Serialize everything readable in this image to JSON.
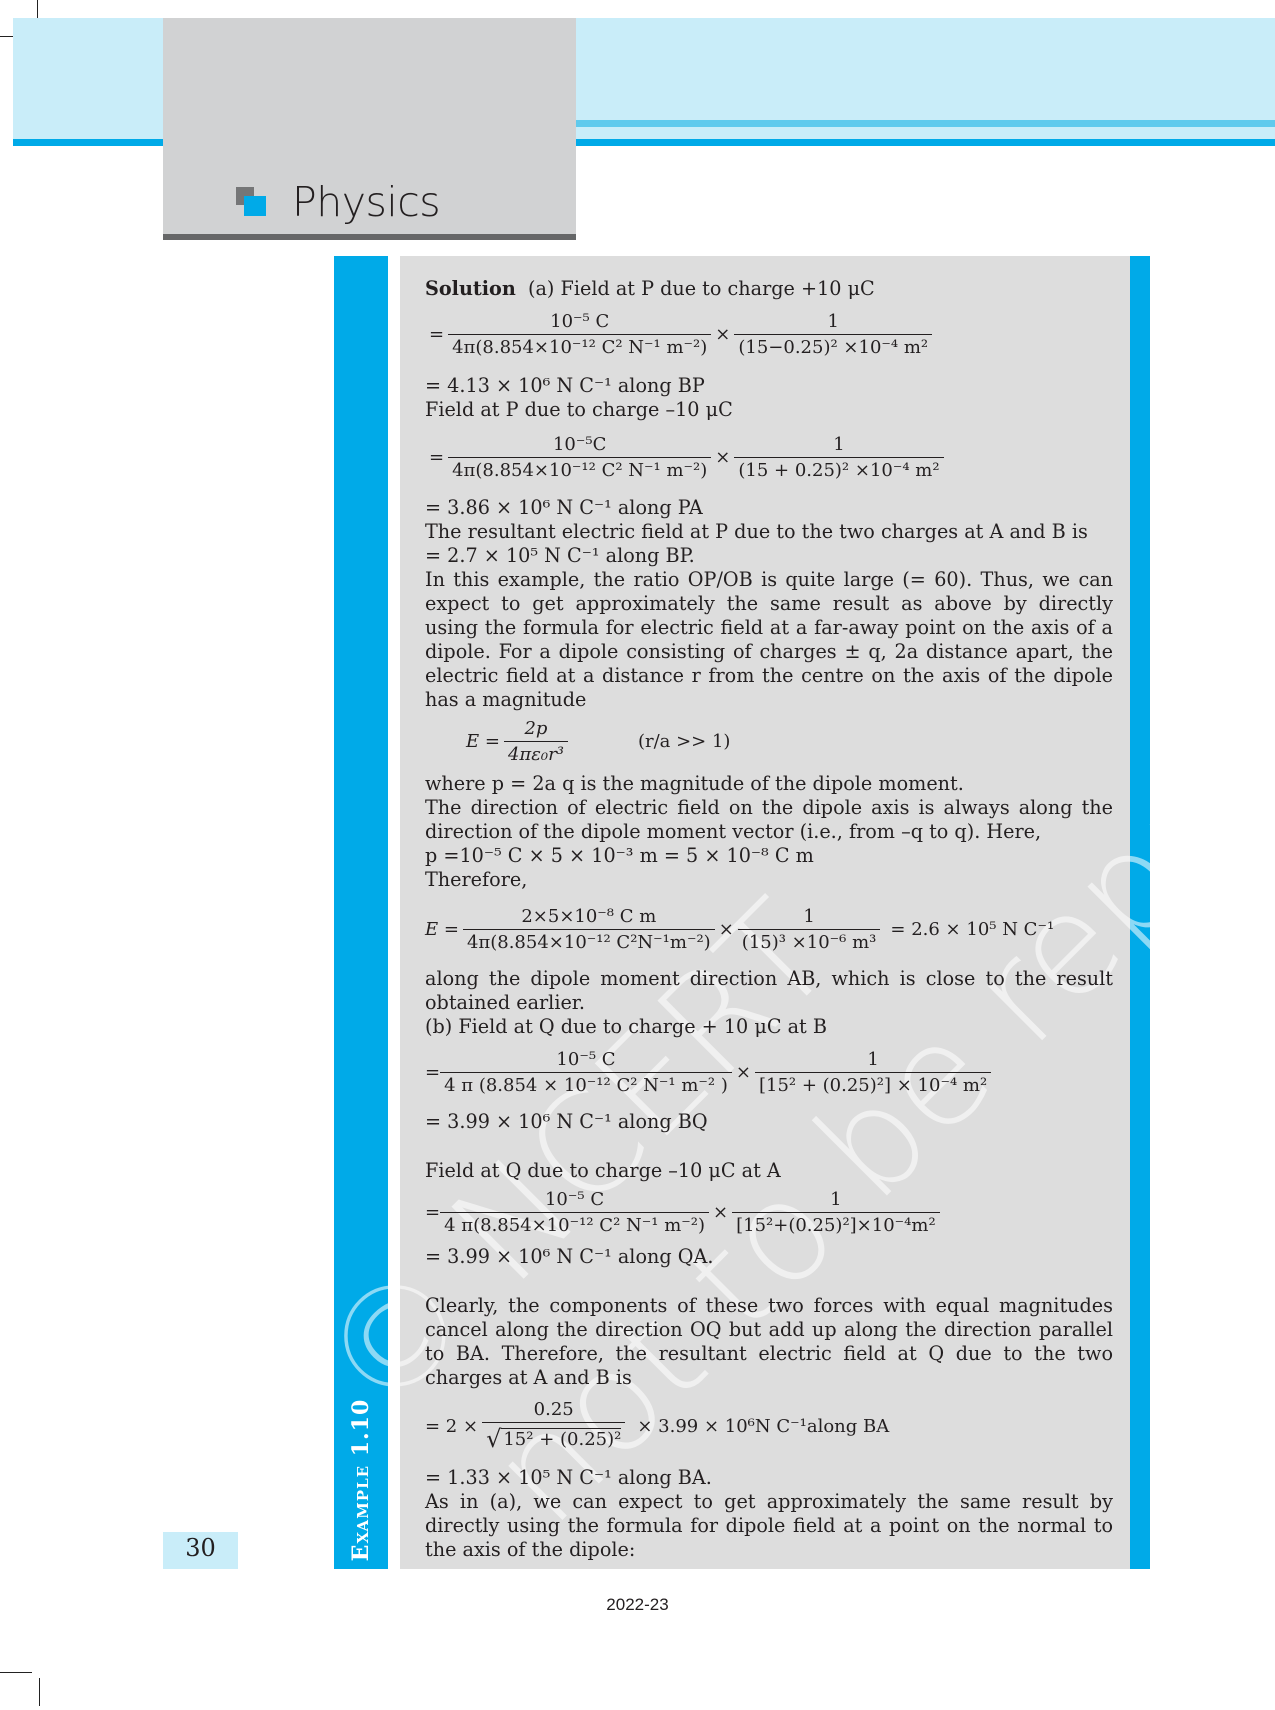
{
  "header": {
    "subject": "Physics",
    "logo_icon": "overlapping-squares-icon",
    "colors": {
      "accent_blue": "#00aae8",
      "light_blue": "#c9edf9",
      "header_grey": "#d1d2d3",
      "content_grey": "#dddddd"
    }
  },
  "example": {
    "label": "Example 1.10"
  },
  "watermark": {
    "line1": "© NCERT",
    "line2": "not to be republished"
  },
  "solution": {
    "heading": "Solution",
    "part_a_intro": "(a) Field at P due to charge +10 μC",
    "eq1": {
      "prefix": "=",
      "f1_num": "10⁻⁵ C",
      "f1_den": "4π(8.854×10⁻¹² C² N⁻¹ m⁻²)",
      "times": "×",
      "f2_num": "1",
      "f2_den": "(15−0.25)² ×10⁻⁴ m²"
    },
    "result1": "=  4.13 × 10⁶  N C⁻¹  along BP",
    "field_minus_intro": "Field at P due to charge –10 μC",
    "eq2": {
      "prefix": "=",
      "f1_num": "10⁻⁵C",
      "f1_den": "4π(8.854×10⁻¹² C² N⁻¹ m⁻²)",
      "times": "×",
      "f2_num": "1",
      "f2_den": "(15 + 0.25)² ×10⁻⁴ m²"
    },
    "result2": "=  3.86 × 10⁶  N C⁻¹ along PA",
    "resultant_line": "The resultant electric field at P due to the two charges at A and B is",
    "resultant_value": "=  2.7 × 10⁵  N C⁻¹  along BP.",
    "paragraph1": "In this example, the ratio OP/OB is quite large (= 60). Thus, we can expect to get approximately the same result as above by directly using the formula for electric field at a far-away point on the axis of a dipole. For a dipole consisting of charges ± q, 2a distance apart, the electric field at a distance r from the centre on the axis of the dipole has a magnitude",
    "dipole_eq": {
      "lhs": "E =",
      "num": "2p",
      "den": "4πε₀r³",
      "condition": "(r/a >> 1)"
    },
    "where_line": "where p = 2a q is the magnitude of the dipole moment.",
    "paragraph2": "The direction of electric field on the dipole axis is always along the direction of the dipole moment vector (i.e., from –q to q). Here,",
    "p_value": "p =10⁻⁵ C × 5 × 10⁻³ m  = 5 × 10⁻⁸ C m",
    "therefore": "Therefore,",
    "eq3": {
      "lhs": "E  =",
      "f1_num": "2×5×10⁻⁸ C m",
      "f1_den": "4π(8.854×10⁻¹² C²N⁻¹m⁻²)",
      "times": "×",
      "f2_num": "1",
      "f2_den": "(15)³ ×10⁻⁶ m³",
      "result": "= 2.6 × 10⁵  N C⁻¹"
    },
    "paragraph3": "along the dipole moment direction AB, which is close to the result obtained earlier.",
    "part_b_intro": "(b) Field at Q due to charge + 10 μC at B",
    "eq4": {
      "prefix": "=",
      "f1_num": "10⁻⁵ C",
      "f1_den": "4 π (8.854 × 10⁻¹² C²  N⁻¹  m⁻² )",
      "times": "×",
      "f2_num": "1",
      "f2_den": "[15² + (0.25)²] × 10⁻⁴  m²"
    },
    "result4": "=  3.99 × 10⁶  N C⁻¹ along BQ",
    "field_q_minus_intro": "Field at Q due to charge –10 μC at A",
    "eq5": {
      "prefix": "=",
      "f1_num": "10⁻⁵ C",
      "f1_den": "4 π(8.854×10⁻¹² C² N⁻¹ m⁻²)",
      "times": "×",
      "f2_num": "1",
      "f2_den": "[15²+(0.25)²]×10⁻⁴m²"
    },
    "result5": "=  3.99 × 10⁶  N C⁻¹ along QA.",
    "paragraph4": "Clearly, the components of these two forces with equal magnitudes cancel along the direction OQ but add up along the direction parallel to BA. Therefore, the resultant electric field at Q due to the two charges at A and B is",
    "eq6": {
      "prefix": "= 2 ×",
      "num": "0.25",
      "den_radicand": "15²  +  (0.25)²",
      "rest": "×  3.99  ×  10⁶N C⁻¹along BA"
    },
    "result6": "=  1.33 × 10⁵  N C⁻¹ along BA.",
    "paragraph5": "As in (a), we can expect to get approximately the same result by directly using the formula for dipole field at a point on the normal to the axis of the dipole:"
  },
  "footer": {
    "page_number": "30",
    "year": "2022-23"
  }
}
